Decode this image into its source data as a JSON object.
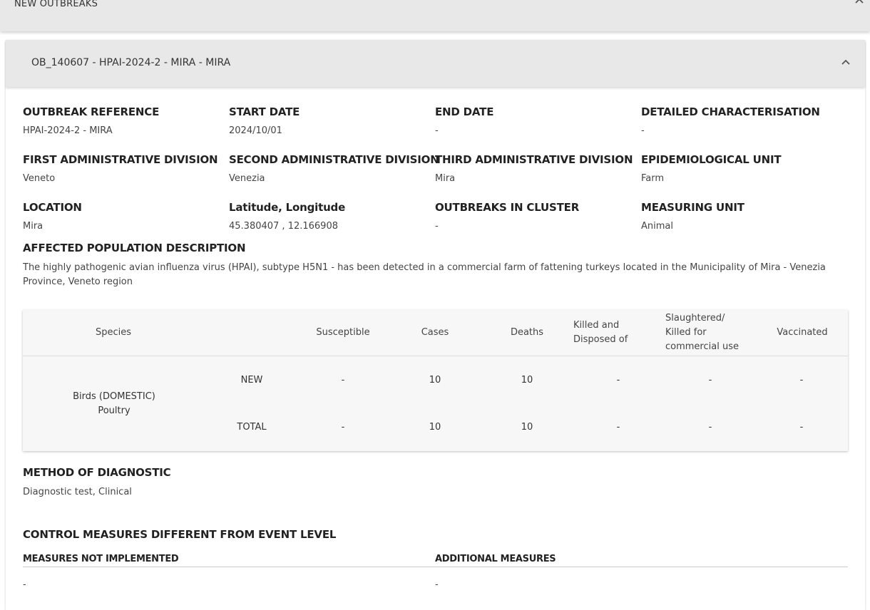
{
  "top_section": {
    "title": "NEW OUTBREAKS"
  },
  "panel": {
    "title": "OB_140607 - HPAI-2024-2 - MIRA - MIRA"
  },
  "fields": {
    "outbreak_reference": {
      "label": "OUTBREAK REFERENCE",
      "value": "HPAI-2024-2 - MIRA"
    },
    "start_date": {
      "label": "START DATE",
      "value": "2024/10/01"
    },
    "end_date": {
      "label": "END DATE",
      "value": "-"
    },
    "detailed_characterisation": {
      "label": "DETAILED CHARACTERISATION",
      "value": "-"
    },
    "first_admin_division": {
      "label": "FIRST ADMINISTRATIVE DIVISION",
      "value": "Veneto"
    },
    "second_admin_division": {
      "label": "SECOND ADMINISTRATIVE DIVISION",
      "value": "Venezia"
    },
    "third_admin_division": {
      "label": "THIRD ADMINISTRATIVE DIVISION",
      "value": "Mira"
    },
    "epidemiological_unit": {
      "label": "EPIDEMIOLOGICAL UNIT",
      "value": "Farm"
    },
    "location": {
      "label": "LOCATION",
      "value": "Mira"
    },
    "lat_long": {
      "label": "Latitude, Longitude",
      "value": "45.380407 , 12.166908"
    },
    "outbreaks_in_cluster": {
      "label": "OUTBREAKS IN CLUSTER",
      "value": "-"
    },
    "measuring_unit": {
      "label": "MEASURING UNIT",
      "value": "Animal"
    }
  },
  "affected_population": {
    "label": "AFFECTED POPULATION DESCRIPTION",
    "text": "The highly pathogenic avian influenza virus (HPAI), subtype H5N1 - has been detected in a commercial farm of fattening turkeys located in the Municipality of Mira - Venezia Province, Veneto region"
  },
  "species_table": {
    "headers": {
      "species": "Species",
      "susceptible": "Susceptible",
      "cases": "Cases",
      "deaths": "Deaths",
      "killed_disposed": [
        "Killed and",
        "Disposed of"
      ],
      "slaughtered": [
        "Slaughtered/",
        "Killed for",
        "commercial use"
      ],
      "vaccinated": "Vaccinated"
    },
    "species_name": [
      "Birds (DOMESTIC)",
      "Poultry"
    ],
    "rows": [
      {
        "label": "NEW",
        "susceptible": "-",
        "cases": "10",
        "deaths": "10",
        "killed": "-",
        "slaughtered": "-",
        "vaccinated": "-"
      },
      {
        "label": "TOTAL",
        "susceptible": "-",
        "cases": "10",
        "deaths": "10",
        "killed": "-",
        "slaughtered": "-",
        "vaccinated": "-"
      }
    ]
  },
  "method_of_diagnostic": {
    "label": "METHOD OF DIAGNOSTIC",
    "value": "Diagnostic test, Clinical"
  },
  "control_measures": {
    "label": "CONTROL MEASURES DIFFERENT FROM EVENT LEVEL",
    "not_implemented": {
      "label": "MEASURES NOT IMPLEMENTED",
      "value": "-"
    },
    "additional": {
      "label": "ADDITIONAL MEASURES",
      "value": "-"
    }
  },
  "icons": {
    "collapse": "chevron-up-icon"
  }
}
